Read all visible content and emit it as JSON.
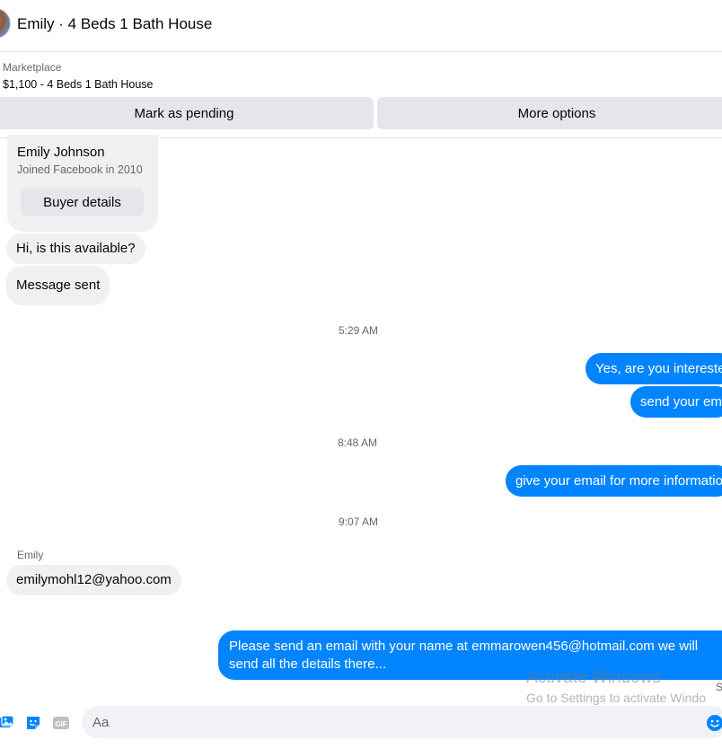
{
  "header": {
    "title": "Emily · 4 Beds 1 Bath House"
  },
  "listing": {
    "category": "Marketplace",
    "item": "$1,100 - 4 Beds 1 Bath House"
  },
  "actions": {
    "mark_pending": "Mark as pending",
    "more_options": "More options"
  },
  "profile": {
    "name": "Emily Johnson",
    "joined": "Joined Facebook in 2010",
    "buyer_details": "Buyer details"
  },
  "messages": {
    "hi": "Hi, is this available?",
    "sent": "Message sent",
    "time1": "5:29 AM",
    "yes": "Yes, are you intereste",
    "send_email": "send your em",
    "time2": "8:48 AM",
    "give_email": "give your email for more informatio",
    "time3": "9:07 AM",
    "sender": "Emily",
    "email": "emilymohl12@yahoo.com",
    "please": "Please send an email with your name at emmarowen456@hotmail.com we will send all the details there..."
  },
  "watermark": {
    "line1": "Activate Windows",
    "line2": "Go to Settings to activate Windo",
    "side": "S"
  },
  "composer": {
    "placeholder": "Aa"
  },
  "colors": {
    "accent": "#0084ff",
    "incoming_bubble": "#f0f0f0",
    "button_bg": "#e4e6eb"
  },
  "icons": [
    "photo-icon",
    "sticker-icon",
    "gif-icon",
    "emoji-icon"
  ]
}
